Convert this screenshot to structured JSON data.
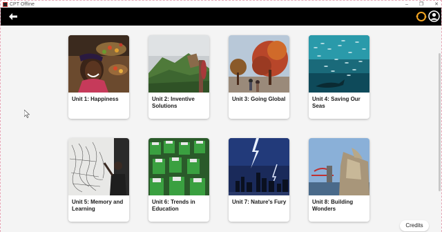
{
  "window": {
    "title": "CPT Offline",
    "controls": [
      "–",
      "❐",
      "✕"
    ]
  },
  "header": {
    "back_icon": "arrow-left-icon",
    "sync_icon": "sync-icon",
    "profile_icon": "user-circle-icon",
    "accent_color": "#f5a623"
  },
  "units": [
    {
      "label": "Unit 1: Happiness",
      "image": "smiling-woman-market-photo"
    },
    {
      "label": "Unit 2: Inventive Solutions",
      "image": "mountain-sign-photo"
    },
    {
      "label": "Unit 3: Going Global",
      "image": "autumn-trees-street-photo"
    },
    {
      "label": "Unit 4: Saving Our Seas",
      "image": "fish-school-photo"
    },
    {
      "label": "Unit 5: Memory and Learning",
      "image": "man-drawing-wall-photo"
    },
    {
      "label": "Unit 6: Trends in Education",
      "image": "students-vr-headsets-photo"
    },
    {
      "label": "Unit 7: Nature's Fury",
      "image": "lightning-city-photo"
    },
    {
      "label": "Unit 8: Building Wonders",
      "image": "modern-architecture-photo"
    }
  ],
  "footer": {
    "credits_label": "Credits"
  }
}
